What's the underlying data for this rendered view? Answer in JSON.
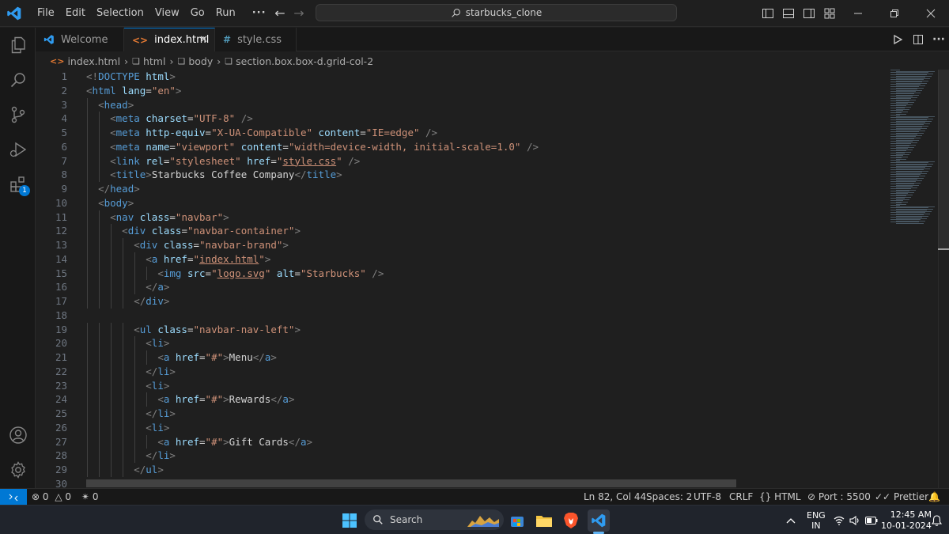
{
  "titlebar": {
    "menu": [
      "File",
      "Edit",
      "Selection",
      "View",
      "Go",
      "Run",
      "···"
    ],
    "command_center": "starbucks_clone"
  },
  "activity": {
    "extensions_badge": "1"
  },
  "tabs": [
    {
      "label": "Welcome",
      "icon": "vscode-icon"
    },
    {
      "label": "index.html",
      "icon": "html-icon",
      "active": true
    },
    {
      "label": "style.css",
      "icon": "css-icon"
    }
  ],
  "breadcrumb": [
    "index.html",
    "html",
    "body",
    "section.box.box-d.grid-col-2"
  ],
  "editor": {
    "line_numbers": [
      "1",
      "2",
      "3",
      "4",
      "5",
      "6",
      "7",
      "8",
      "9",
      "10",
      "11",
      "12",
      "13",
      "14",
      "15",
      "16",
      "17",
      "18",
      "19",
      "20",
      "21",
      "22",
      "23",
      "24",
      "25",
      "26",
      "27",
      "28",
      "29",
      "30"
    ],
    "lines": [
      [
        {
          "t": "<!",
          "c": "br"
        },
        {
          "t": "DOCTYPE ",
          "c": "tag"
        },
        {
          "t": "html",
          "c": "attr"
        },
        {
          "t": ">",
          "c": "br"
        }
      ],
      [
        {
          "t": "<",
          "c": "br"
        },
        {
          "t": "html ",
          "c": "tag"
        },
        {
          "t": "lang",
          "c": "attr"
        },
        {
          "t": "=",
          "c": "txt"
        },
        {
          "t": "\"en\"",
          "c": "str"
        },
        {
          "t": ">",
          "c": "br"
        }
      ],
      [
        {
          "t": "  "
        },
        {
          "t": "<",
          "c": "br"
        },
        {
          "t": "head",
          "c": "tag"
        },
        {
          "t": ">",
          "c": "br"
        }
      ],
      [
        {
          "t": "    "
        },
        {
          "t": "<",
          "c": "br"
        },
        {
          "t": "meta ",
          "c": "tag"
        },
        {
          "t": "charset",
          "c": "attr"
        },
        {
          "t": "=",
          "c": "txt"
        },
        {
          "t": "\"UTF-8\"",
          "c": "str"
        },
        {
          "t": " />",
          "c": "br"
        }
      ],
      [
        {
          "t": "    "
        },
        {
          "t": "<",
          "c": "br"
        },
        {
          "t": "meta ",
          "c": "tag"
        },
        {
          "t": "http-equiv",
          "c": "attr"
        },
        {
          "t": "=",
          "c": "txt"
        },
        {
          "t": "\"X-UA-Compatible\"",
          "c": "str"
        },
        {
          "t": " "
        },
        {
          "t": "content",
          "c": "attr"
        },
        {
          "t": "=",
          "c": "txt"
        },
        {
          "t": "\"IE=edge\"",
          "c": "str"
        },
        {
          "t": " />",
          "c": "br"
        }
      ],
      [
        {
          "t": "    "
        },
        {
          "t": "<",
          "c": "br"
        },
        {
          "t": "meta ",
          "c": "tag"
        },
        {
          "t": "name",
          "c": "attr"
        },
        {
          "t": "=",
          "c": "txt"
        },
        {
          "t": "\"viewport\"",
          "c": "str"
        },
        {
          "t": " "
        },
        {
          "t": "content",
          "c": "attr"
        },
        {
          "t": "=",
          "c": "txt"
        },
        {
          "t": "\"width=device-width, initial-scale=1.0\"",
          "c": "str"
        },
        {
          "t": " />",
          "c": "br"
        }
      ],
      [
        {
          "t": "    "
        },
        {
          "t": "<",
          "c": "br"
        },
        {
          "t": "link ",
          "c": "tag"
        },
        {
          "t": "rel",
          "c": "attr"
        },
        {
          "t": "=",
          "c": "txt"
        },
        {
          "t": "\"stylesheet\"",
          "c": "str"
        },
        {
          "t": " "
        },
        {
          "t": "href",
          "c": "attr"
        },
        {
          "t": "=",
          "c": "txt"
        },
        {
          "t": "\"",
          "c": "str"
        },
        {
          "t": "style.css",
          "c": "str",
          "u": true
        },
        {
          "t": "\"",
          "c": "str"
        },
        {
          "t": " />",
          "c": "br"
        }
      ],
      [
        {
          "t": "    "
        },
        {
          "t": "<",
          "c": "br"
        },
        {
          "t": "title",
          "c": "tag"
        },
        {
          "t": ">",
          "c": "br"
        },
        {
          "t": "Starbucks Coffee Company",
          "c": "txt"
        },
        {
          "t": "</",
          "c": "br"
        },
        {
          "t": "title",
          "c": "tag"
        },
        {
          "t": ">",
          "c": "br"
        }
      ],
      [
        {
          "t": "  "
        },
        {
          "t": "</",
          "c": "br"
        },
        {
          "t": "head",
          "c": "tag"
        },
        {
          "t": ">",
          "c": "br"
        }
      ],
      [
        {
          "t": "  "
        },
        {
          "t": "<",
          "c": "br"
        },
        {
          "t": "body",
          "c": "tag"
        },
        {
          "t": ">",
          "c": "br"
        }
      ],
      [
        {
          "t": "    "
        },
        {
          "t": "<",
          "c": "br"
        },
        {
          "t": "nav ",
          "c": "tag"
        },
        {
          "t": "class",
          "c": "attr"
        },
        {
          "t": "=",
          "c": "txt"
        },
        {
          "t": "\"navbar\"",
          "c": "str"
        },
        {
          "t": ">",
          "c": "br"
        }
      ],
      [
        {
          "t": "      "
        },
        {
          "t": "<",
          "c": "br"
        },
        {
          "t": "div ",
          "c": "tag"
        },
        {
          "t": "class",
          "c": "attr"
        },
        {
          "t": "=",
          "c": "txt"
        },
        {
          "t": "\"navbar-container\"",
          "c": "str"
        },
        {
          "t": ">",
          "c": "br"
        }
      ],
      [
        {
          "t": "        "
        },
        {
          "t": "<",
          "c": "br"
        },
        {
          "t": "div ",
          "c": "tag"
        },
        {
          "t": "class",
          "c": "attr"
        },
        {
          "t": "=",
          "c": "txt"
        },
        {
          "t": "\"navbar-brand\"",
          "c": "str"
        },
        {
          "t": ">",
          "c": "br"
        }
      ],
      [
        {
          "t": "          "
        },
        {
          "t": "<",
          "c": "br"
        },
        {
          "t": "a ",
          "c": "tag"
        },
        {
          "t": "href",
          "c": "attr"
        },
        {
          "t": "=",
          "c": "txt"
        },
        {
          "t": "\"",
          "c": "str"
        },
        {
          "t": "index.html",
          "c": "str",
          "u": true
        },
        {
          "t": "\"",
          "c": "str"
        },
        {
          "t": ">",
          "c": "br"
        }
      ],
      [
        {
          "t": "            "
        },
        {
          "t": "<",
          "c": "br"
        },
        {
          "t": "img ",
          "c": "tag"
        },
        {
          "t": "src",
          "c": "attr"
        },
        {
          "t": "=",
          "c": "txt"
        },
        {
          "t": "\"",
          "c": "str"
        },
        {
          "t": "logo.svg",
          "c": "str",
          "u": true
        },
        {
          "t": "\"",
          "c": "str"
        },
        {
          "t": " "
        },
        {
          "t": "alt",
          "c": "attr"
        },
        {
          "t": "=",
          "c": "txt"
        },
        {
          "t": "\"Starbucks\"",
          "c": "str"
        },
        {
          "t": " />",
          "c": "br"
        }
      ],
      [
        {
          "t": "          "
        },
        {
          "t": "</",
          "c": "br"
        },
        {
          "t": "a",
          "c": "tag"
        },
        {
          "t": ">",
          "c": "br"
        }
      ],
      [
        {
          "t": "        "
        },
        {
          "t": "</",
          "c": "br"
        },
        {
          "t": "div",
          "c": "tag"
        },
        {
          "t": ">",
          "c": "br"
        }
      ],
      [],
      [
        {
          "t": "        "
        },
        {
          "t": "<",
          "c": "br"
        },
        {
          "t": "ul ",
          "c": "tag"
        },
        {
          "t": "class",
          "c": "attr"
        },
        {
          "t": "=",
          "c": "txt"
        },
        {
          "t": "\"navbar-nav-left\"",
          "c": "str"
        },
        {
          "t": ">",
          "c": "br"
        }
      ],
      [
        {
          "t": "          "
        },
        {
          "t": "<",
          "c": "br"
        },
        {
          "t": "li",
          "c": "tag"
        },
        {
          "t": ">",
          "c": "br"
        }
      ],
      [
        {
          "t": "            "
        },
        {
          "t": "<",
          "c": "br"
        },
        {
          "t": "a ",
          "c": "tag"
        },
        {
          "t": "href",
          "c": "attr"
        },
        {
          "t": "=",
          "c": "txt"
        },
        {
          "t": "\"#\"",
          "c": "str"
        },
        {
          "t": ">",
          "c": "br"
        },
        {
          "t": "Menu",
          "c": "txt"
        },
        {
          "t": "</",
          "c": "br"
        },
        {
          "t": "a",
          "c": "tag"
        },
        {
          "t": ">",
          "c": "br"
        }
      ],
      [
        {
          "t": "          "
        },
        {
          "t": "</",
          "c": "br"
        },
        {
          "t": "li",
          "c": "tag"
        },
        {
          "t": ">",
          "c": "br"
        }
      ],
      [
        {
          "t": "          "
        },
        {
          "t": "<",
          "c": "br"
        },
        {
          "t": "li",
          "c": "tag"
        },
        {
          "t": ">",
          "c": "br"
        }
      ],
      [
        {
          "t": "            "
        },
        {
          "t": "<",
          "c": "br"
        },
        {
          "t": "a ",
          "c": "tag"
        },
        {
          "t": "href",
          "c": "attr"
        },
        {
          "t": "=",
          "c": "txt"
        },
        {
          "t": "\"#\"",
          "c": "str"
        },
        {
          "t": ">",
          "c": "br"
        },
        {
          "t": "Rewards",
          "c": "txt"
        },
        {
          "t": "</",
          "c": "br"
        },
        {
          "t": "a",
          "c": "tag"
        },
        {
          "t": ">",
          "c": "br"
        }
      ],
      [
        {
          "t": "          "
        },
        {
          "t": "</",
          "c": "br"
        },
        {
          "t": "li",
          "c": "tag"
        },
        {
          "t": ">",
          "c": "br"
        }
      ],
      [
        {
          "t": "          "
        },
        {
          "t": "<",
          "c": "br"
        },
        {
          "t": "li",
          "c": "tag"
        },
        {
          "t": ">",
          "c": "br"
        }
      ],
      [
        {
          "t": "            "
        },
        {
          "t": "<",
          "c": "br"
        },
        {
          "t": "a ",
          "c": "tag"
        },
        {
          "t": "href",
          "c": "attr"
        },
        {
          "t": "=",
          "c": "txt"
        },
        {
          "t": "\"#\"",
          "c": "str"
        },
        {
          "t": ">",
          "c": "br"
        },
        {
          "t": "Gift Cards",
          "c": "txt"
        },
        {
          "t": "</",
          "c": "br"
        },
        {
          "t": "a",
          "c": "tag"
        },
        {
          "t": ">",
          "c": "br"
        }
      ],
      [
        {
          "t": "          "
        },
        {
          "t": "</",
          "c": "br"
        },
        {
          "t": "li",
          "c": "tag"
        },
        {
          "t": ">",
          "c": "br"
        }
      ],
      [
        {
          "t": "        "
        },
        {
          "t": "</",
          "c": "br"
        },
        {
          "t": "ul",
          "c": "tag"
        },
        {
          "t": ">",
          "c": "br"
        }
      ],
      []
    ]
  },
  "statusbar": {
    "errors": "0",
    "warnings": "0",
    "ports_forwarded": "0",
    "cursor": "Ln 82, Col 44",
    "spaces": "Spaces: 2",
    "encoding": "UTF-8",
    "eol": "CRLF",
    "language": "HTML",
    "port": "Port : 5500",
    "formatter": "Prettier"
  },
  "taskbar": {
    "search_label": "Search",
    "lang_line1": "ENG",
    "lang_line2": "IN",
    "time": "12:45 AM",
    "date": "10-01-2024"
  },
  "colors": {
    "accent": "#0078d4",
    "tag": "#569cd6",
    "attribute": "#9cdcfe",
    "string": "#ce9178",
    "punctuation": "#808080"
  }
}
